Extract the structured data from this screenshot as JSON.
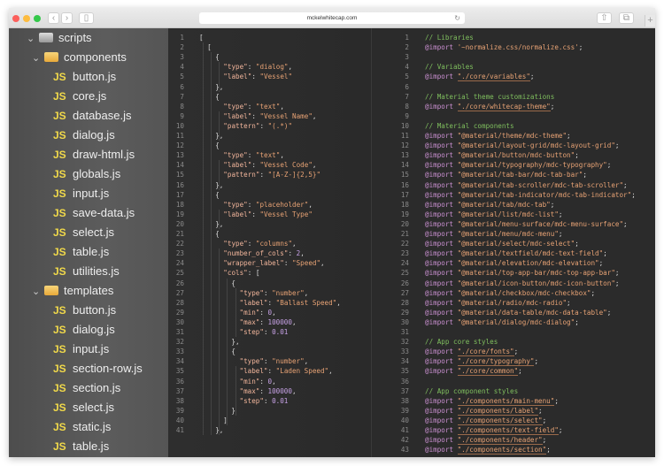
{
  "browser": {
    "url": "mckelwhitecap.com",
    "colors": {
      "close": "#fc605c",
      "min": "#fdbc40",
      "max": "#34c84a"
    }
  },
  "sidebar": {
    "items": [
      {
        "level": 0,
        "kind": "folder",
        "label": "scripts",
        "icon": "folder-icon"
      },
      {
        "level": 1,
        "kind": "folder",
        "label": "components",
        "icon": "folder-open-icon"
      },
      {
        "level": 2,
        "kind": "file",
        "label": "button.js"
      },
      {
        "level": 2,
        "kind": "file",
        "label": "core.js"
      },
      {
        "level": 2,
        "kind": "file",
        "label": "database.js"
      },
      {
        "level": 2,
        "kind": "file",
        "label": "dialog.js"
      },
      {
        "level": 2,
        "kind": "file",
        "label": "draw-html.js"
      },
      {
        "level": 2,
        "kind": "file",
        "label": "globals.js"
      },
      {
        "level": 2,
        "kind": "file",
        "label": "input.js"
      },
      {
        "level": 2,
        "kind": "file",
        "label": "save-data.js"
      },
      {
        "level": 2,
        "kind": "file",
        "label": "select.js"
      },
      {
        "level": 2,
        "kind": "file",
        "label": "table.js"
      },
      {
        "level": 2,
        "kind": "file",
        "label": "utilities.js"
      },
      {
        "level": 1,
        "kind": "folder",
        "label": "templates",
        "icon": "folder-open-icon"
      },
      {
        "level": 2,
        "kind": "file",
        "label": "button.js"
      },
      {
        "level": 2,
        "kind": "file",
        "label": "dialog.js"
      },
      {
        "level": 2,
        "kind": "file",
        "label": "input.js"
      },
      {
        "level": 2,
        "kind": "file",
        "label": "section-row.js"
      },
      {
        "level": 2,
        "kind": "file",
        "label": "section.js"
      },
      {
        "level": 2,
        "kind": "file",
        "label": "select.js"
      },
      {
        "level": 2,
        "kind": "file",
        "label": "static.js"
      },
      {
        "level": 2,
        "kind": "file",
        "label": "table.js"
      }
    ],
    "js_badge": "JS"
  },
  "left_editor": {
    "lines": [
      [
        0,
        [
          [
            "pun",
            "["
          ]
        ]
      ],
      [
        1,
        [
          [
            "pun",
            "["
          ]
        ]
      ],
      [
        2,
        [
          [
            "pun",
            "{"
          ]
        ]
      ],
      [
        3,
        [
          [
            "key",
            "\"type\""
          ],
          [
            "pun",
            ": "
          ],
          [
            "str",
            "\"dialog\""
          ],
          [
            "pun",
            ","
          ]
        ]
      ],
      [
        3,
        [
          [
            "key",
            "\"label\""
          ],
          [
            "pun",
            ": "
          ],
          [
            "str",
            "\"Vessel\""
          ]
        ]
      ],
      [
        2,
        [
          [
            "pun",
            "},"
          ]
        ]
      ],
      [
        2,
        [
          [
            "pun",
            "{"
          ]
        ]
      ],
      [
        3,
        [
          [
            "key",
            "\"type\""
          ],
          [
            "pun",
            ": "
          ],
          [
            "str",
            "\"text\""
          ],
          [
            "pun",
            ","
          ]
        ]
      ],
      [
        3,
        [
          [
            "key",
            "\"label\""
          ],
          [
            "pun",
            ": "
          ],
          [
            "str",
            "\"Vessel Name\""
          ],
          [
            "pun",
            ","
          ]
        ]
      ],
      [
        3,
        [
          [
            "key",
            "\"pattern\""
          ],
          [
            "pun",
            ": "
          ],
          [
            "str",
            "\"(.*)\""
          ]
        ]
      ],
      [
        2,
        [
          [
            "pun",
            "},"
          ]
        ]
      ],
      [
        2,
        [
          [
            "pun",
            "{"
          ]
        ]
      ],
      [
        3,
        [
          [
            "key",
            "\"type\""
          ],
          [
            "pun",
            ": "
          ],
          [
            "str",
            "\"text\""
          ],
          [
            "pun",
            ","
          ]
        ]
      ],
      [
        3,
        [
          [
            "key",
            "\"label\""
          ],
          [
            "pun",
            ": "
          ],
          [
            "str",
            "\"Vessel Code\""
          ],
          [
            "pun",
            ","
          ]
        ]
      ],
      [
        3,
        [
          [
            "key",
            "\"pattern\""
          ],
          [
            "pun",
            ": "
          ],
          [
            "str",
            "\"[A-Z-]{2,5}\""
          ]
        ]
      ],
      [
        2,
        [
          [
            "pun",
            "},"
          ]
        ]
      ],
      [
        2,
        [
          [
            "pun",
            "{"
          ]
        ]
      ],
      [
        3,
        [
          [
            "key",
            "\"type\""
          ],
          [
            "pun",
            ": "
          ],
          [
            "str",
            "\"placeholder\""
          ],
          [
            "pun",
            ","
          ]
        ]
      ],
      [
        3,
        [
          [
            "key",
            "\"label\""
          ],
          [
            "pun",
            ": "
          ],
          [
            "str",
            "\"Vessel Type\""
          ]
        ]
      ],
      [
        2,
        [
          [
            "pun",
            "},"
          ]
        ]
      ],
      [
        2,
        [
          [
            "pun",
            "{"
          ]
        ]
      ],
      [
        3,
        [
          [
            "key",
            "\"type\""
          ],
          [
            "pun",
            ": "
          ],
          [
            "str",
            "\"columns\""
          ],
          [
            "pun",
            ","
          ]
        ]
      ],
      [
        3,
        [
          [
            "key",
            "\"number_of_cols\""
          ],
          [
            "pun",
            ": "
          ],
          [
            "num",
            "2"
          ],
          [
            "pun",
            ","
          ]
        ]
      ],
      [
        3,
        [
          [
            "key",
            "\"wrapper_label\""
          ],
          [
            "pun",
            ": "
          ],
          [
            "str",
            "\"Speed\""
          ],
          [
            "pun",
            ","
          ]
        ]
      ],
      [
        3,
        [
          [
            "key",
            "\"cols\""
          ],
          [
            "pun",
            ": ["
          ]
        ]
      ],
      [
        4,
        [
          [
            "pun",
            "{"
          ]
        ]
      ],
      [
        5,
        [
          [
            "key",
            "\"type\""
          ],
          [
            "pun",
            ": "
          ],
          [
            "str",
            "\"number\""
          ],
          [
            "pun",
            ","
          ]
        ]
      ],
      [
        5,
        [
          [
            "key",
            "\"label\""
          ],
          [
            "pun",
            ": "
          ],
          [
            "str",
            "\"Ballast Speed\""
          ],
          [
            "pun",
            ","
          ]
        ]
      ],
      [
        5,
        [
          [
            "key",
            "\"min\""
          ],
          [
            "pun",
            ": "
          ],
          [
            "num",
            "0"
          ],
          [
            "pun",
            ","
          ]
        ]
      ],
      [
        5,
        [
          [
            "key",
            "\"max\""
          ],
          [
            "pun",
            ": "
          ],
          [
            "num",
            "100000"
          ],
          [
            "pun",
            ","
          ]
        ]
      ],
      [
        5,
        [
          [
            "key",
            "\"step\""
          ],
          [
            "pun",
            ": "
          ],
          [
            "num",
            "0.01"
          ]
        ]
      ],
      [
        4,
        [
          [
            "pun",
            "},"
          ]
        ]
      ],
      [
        4,
        [
          [
            "pun",
            "{"
          ]
        ]
      ],
      [
        5,
        [
          [
            "key",
            "\"type\""
          ],
          [
            "pun",
            ": "
          ],
          [
            "str",
            "\"number\""
          ],
          [
            "pun",
            ","
          ]
        ]
      ],
      [
        5,
        [
          [
            "key",
            "\"label\""
          ],
          [
            "pun",
            ": "
          ],
          [
            "str",
            "\"Laden Speed\""
          ],
          [
            "pun",
            ","
          ]
        ]
      ],
      [
        5,
        [
          [
            "key",
            "\"min\""
          ],
          [
            "pun",
            ": "
          ],
          [
            "num",
            "0"
          ],
          [
            "pun",
            ","
          ]
        ]
      ],
      [
        5,
        [
          [
            "key",
            "\"max\""
          ],
          [
            "pun",
            ": "
          ],
          [
            "num",
            "100000"
          ],
          [
            "pun",
            ","
          ]
        ]
      ],
      [
        5,
        [
          [
            "key",
            "\"step\""
          ],
          [
            "pun",
            ": "
          ],
          [
            "num",
            "0.01"
          ]
        ]
      ],
      [
        4,
        [
          [
            "pun",
            "}"
          ]
        ]
      ],
      [
        3,
        [
          [
            "pun",
            "]"
          ]
        ]
      ],
      [
        2,
        [
          [
            "pun",
            "},"
          ]
        ]
      ]
    ]
  },
  "right_editor": {
    "lines": [
      [
        [
          "com",
          "// Libraries"
        ]
      ],
      [
        [
          "kw",
          "@import"
        ],
        [
          "pun",
          " "
        ],
        [
          "str",
          "'~normalize.css/normalize.css'"
        ],
        [
          "pun",
          ";"
        ]
      ],
      [],
      [
        [
          "com",
          "// Variables"
        ]
      ],
      [
        [
          "kw",
          "@import"
        ],
        [
          "pun",
          " "
        ],
        [
          "path",
          "\"./core/variables\""
        ],
        [
          "pun",
          ";"
        ]
      ],
      [],
      [
        [
          "com",
          "// Material theme customizations"
        ]
      ],
      [
        [
          "kw",
          "@import"
        ],
        [
          "pun",
          " "
        ],
        [
          "path",
          "\"./core/whitecap-theme\""
        ],
        [
          "pun",
          ";"
        ]
      ],
      [],
      [
        [
          "com",
          "// Material components"
        ]
      ],
      [
        [
          "kw",
          "@import"
        ],
        [
          "pun",
          " "
        ],
        [
          "str",
          "\"@material/theme/mdc-theme\""
        ],
        [
          "pun",
          ";"
        ]
      ],
      [
        [
          "kw",
          "@import"
        ],
        [
          "pun",
          " "
        ],
        [
          "str",
          "\"@material/layout-grid/mdc-layout-grid\""
        ],
        [
          "pun",
          ";"
        ]
      ],
      [
        [
          "kw",
          "@import"
        ],
        [
          "pun",
          " "
        ],
        [
          "str",
          "\"@material/button/mdc-button\""
        ],
        [
          "pun",
          ";"
        ]
      ],
      [
        [
          "kw",
          "@import"
        ],
        [
          "pun",
          " "
        ],
        [
          "str",
          "\"@material/typography/mdc-typography\""
        ],
        [
          "pun",
          ";"
        ]
      ],
      [
        [
          "kw",
          "@import"
        ],
        [
          "pun",
          " "
        ],
        [
          "str",
          "\"@material/tab-bar/mdc-tab-bar\""
        ],
        [
          "pun",
          ";"
        ]
      ],
      [
        [
          "kw",
          "@import"
        ],
        [
          "pun",
          " "
        ],
        [
          "str",
          "\"@material/tab-scroller/mdc-tab-scroller\""
        ],
        [
          "pun",
          ";"
        ]
      ],
      [
        [
          "kw",
          "@import"
        ],
        [
          "pun",
          " "
        ],
        [
          "str",
          "\"@material/tab-indicator/mdc-tab-indicator\""
        ],
        [
          "pun",
          ";"
        ]
      ],
      [
        [
          "kw",
          "@import"
        ],
        [
          "pun",
          " "
        ],
        [
          "str",
          "\"@material/tab/mdc-tab\""
        ],
        [
          "pun",
          ";"
        ]
      ],
      [
        [
          "kw",
          "@import"
        ],
        [
          "pun",
          " "
        ],
        [
          "str",
          "\"@material/list/mdc-list\""
        ],
        [
          "pun",
          ";"
        ]
      ],
      [
        [
          "kw",
          "@import"
        ],
        [
          "pun",
          " "
        ],
        [
          "str",
          "\"@material/menu-surface/mdc-menu-surface\""
        ],
        [
          "pun",
          ";"
        ]
      ],
      [
        [
          "kw",
          "@import"
        ],
        [
          "pun",
          " "
        ],
        [
          "str",
          "\"@material/menu/mdc-menu\""
        ],
        [
          "pun",
          ";"
        ]
      ],
      [
        [
          "kw",
          "@import"
        ],
        [
          "pun",
          " "
        ],
        [
          "str",
          "\"@material/select/mdc-select\""
        ],
        [
          "pun",
          ";"
        ]
      ],
      [
        [
          "kw",
          "@import"
        ],
        [
          "pun",
          " "
        ],
        [
          "str",
          "\"@material/textfield/mdc-text-field\""
        ],
        [
          "pun",
          ";"
        ]
      ],
      [
        [
          "kw",
          "@import"
        ],
        [
          "pun",
          " "
        ],
        [
          "str",
          "\"@material/elevation/mdc-elevation\""
        ],
        [
          "pun",
          ";"
        ]
      ],
      [
        [
          "kw",
          "@import"
        ],
        [
          "pun",
          " "
        ],
        [
          "str",
          "\"@material/top-app-bar/mdc-top-app-bar\""
        ],
        [
          "pun",
          ";"
        ]
      ],
      [
        [
          "kw",
          "@import"
        ],
        [
          "pun",
          " "
        ],
        [
          "str",
          "\"@material/icon-button/mdc-icon-button\""
        ],
        [
          "pun",
          ";"
        ]
      ],
      [
        [
          "kw",
          "@import"
        ],
        [
          "pun",
          " "
        ],
        [
          "str",
          "\"@material/checkbox/mdc-checkbox\""
        ],
        [
          "pun",
          ";"
        ]
      ],
      [
        [
          "kw",
          "@import"
        ],
        [
          "pun",
          " "
        ],
        [
          "str",
          "\"@material/radio/mdc-radio\""
        ],
        [
          "pun",
          ";"
        ]
      ],
      [
        [
          "kw",
          "@import"
        ],
        [
          "pun",
          " "
        ],
        [
          "str",
          "\"@material/data-table/mdc-data-table\""
        ],
        [
          "pun",
          ";"
        ]
      ],
      [
        [
          "kw",
          "@import"
        ],
        [
          "pun",
          " "
        ],
        [
          "str",
          "\"@material/dialog/mdc-dialog\""
        ],
        [
          "pun",
          ";"
        ]
      ],
      [],
      [
        [
          "com",
          "// App core styles"
        ]
      ],
      [
        [
          "kw",
          "@import"
        ],
        [
          "pun",
          " "
        ],
        [
          "path",
          "\"./core/fonts\""
        ],
        [
          "pun",
          ";"
        ]
      ],
      [
        [
          "kw",
          "@import"
        ],
        [
          "pun",
          " "
        ],
        [
          "path",
          "\"./core/typography\""
        ],
        [
          "pun",
          ";"
        ]
      ],
      [
        [
          "kw",
          "@import"
        ],
        [
          "pun",
          " "
        ],
        [
          "path",
          "\"./core/common\""
        ],
        [
          "pun",
          ";"
        ]
      ],
      [],
      [
        [
          "com",
          "// App component styles"
        ]
      ],
      [
        [
          "kw",
          "@import"
        ],
        [
          "pun",
          " "
        ],
        [
          "path",
          "\"./components/main-menu\""
        ],
        [
          "pun",
          ";"
        ]
      ],
      [
        [
          "kw",
          "@import"
        ],
        [
          "pun",
          " "
        ],
        [
          "path",
          "\"./components/label\""
        ],
        [
          "pun",
          ";"
        ]
      ],
      [
        [
          "kw",
          "@import"
        ],
        [
          "pun",
          " "
        ],
        [
          "path",
          "\"./components/select\""
        ],
        [
          "pun",
          ";"
        ]
      ],
      [
        [
          "kw",
          "@import"
        ],
        [
          "pun",
          " "
        ],
        [
          "path",
          "\"./components/text-field\""
        ],
        [
          "pun",
          ";"
        ]
      ],
      [
        [
          "kw",
          "@import"
        ],
        [
          "pun",
          " "
        ],
        [
          "path",
          "\"./components/header\""
        ],
        [
          "pun",
          ";"
        ]
      ],
      [
        [
          "kw",
          "@import"
        ],
        [
          "pun",
          " "
        ],
        [
          "path",
          "\"./components/section\""
        ],
        [
          "pun",
          ";"
        ]
      ]
    ]
  }
}
